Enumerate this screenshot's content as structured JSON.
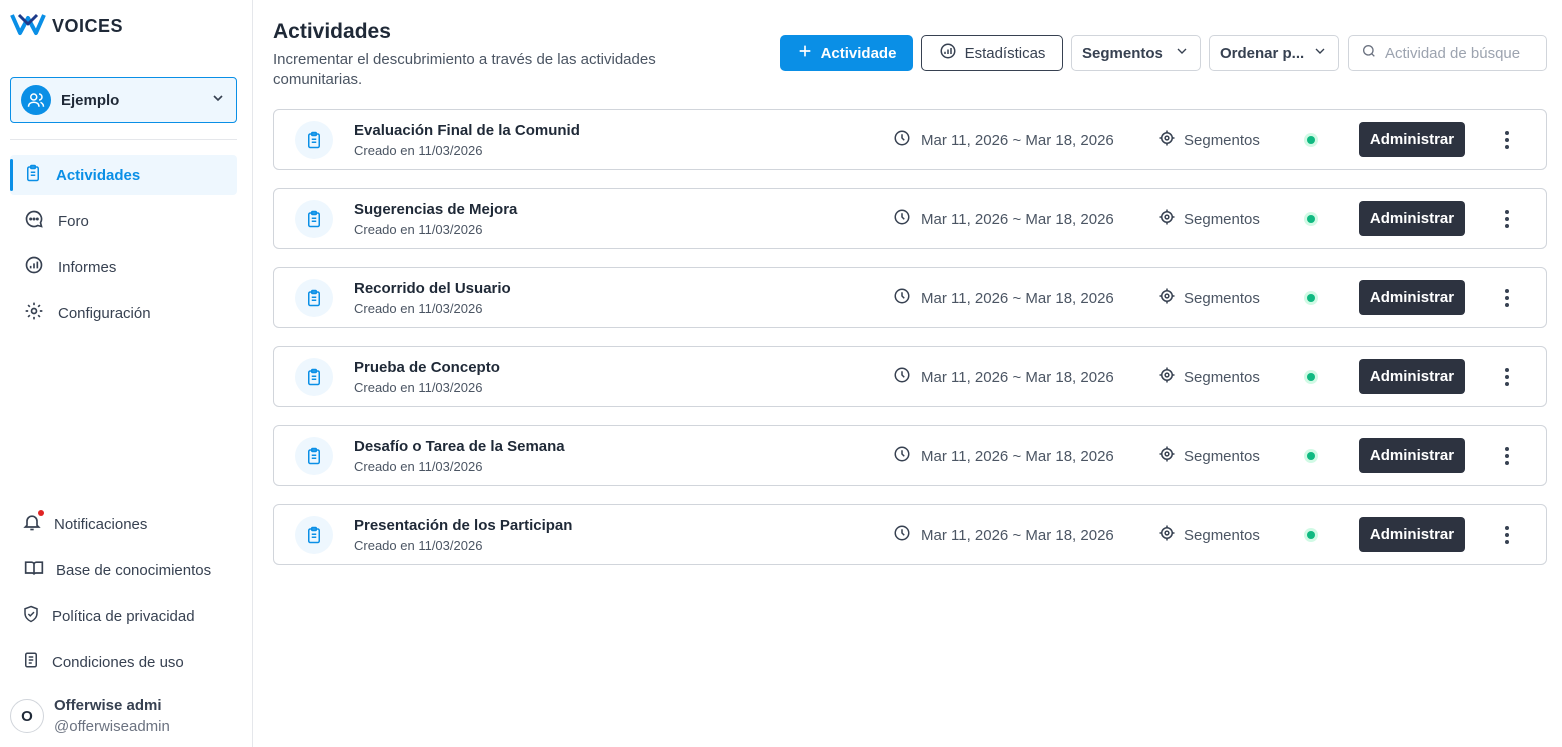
{
  "brand": {
    "name": "VOICES",
    "accent": "#0a8fe6"
  },
  "sidebar": {
    "workspace": "Ejemplo",
    "items": [
      {
        "label": "Actividades",
        "icon": "clipboard-icon",
        "active": true
      },
      {
        "label": "Foro",
        "icon": "chat-icon"
      },
      {
        "label": "Informes",
        "icon": "chart-icon"
      },
      {
        "label": "Configuración",
        "icon": "gear-icon"
      }
    ],
    "bottom": [
      {
        "label": "Notificaciones",
        "icon": "bell-icon"
      },
      {
        "label": "Base de conocimientos",
        "icon": "book-icon"
      },
      {
        "label": "Política de privacidad",
        "icon": "shield-icon"
      },
      {
        "label": "Condiciones de uso",
        "icon": "document-icon"
      }
    ],
    "user": {
      "initial": "O",
      "name": "Offerwise admi",
      "handle": "@offerwiseadmin"
    }
  },
  "header": {
    "title": "Actividades",
    "subtitle": "Incrementar el descubrimiento a través de las actividades comunitarias.",
    "add_label": "Actividade",
    "stats_label": "Estadísticas",
    "segments_label": "Segmentos",
    "sort_label": "Ordenar p...",
    "search_placeholder": "Actividad de búsque"
  },
  "activities": [
    {
      "title": "Evaluación Final de la Comunid",
      "created": "Creado en 11/03/2026",
      "dates": "Mar 11, 2026 ~ Mar 18, 2026",
      "segments": "Segmentos",
      "manage": "Administrar"
    },
    {
      "title": "Sugerencias de Mejora",
      "created": "Creado en 11/03/2026",
      "dates": "Mar 11, 2026 ~ Mar 18, 2026",
      "segments": "Segmentos",
      "manage": "Administrar"
    },
    {
      "title": "Recorrido del Usuario",
      "created": "Creado en 11/03/2026",
      "dates": "Mar 11, 2026 ~ Mar 18, 2026",
      "segments": "Segmentos",
      "manage": "Administrar"
    },
    {
      "title": "Prueba de Concepto",
      "created": "Creado en 11/03/2026",
      "dates": "Mar 11, 2026 ~ Mar 18, 2026",
      "segments": "Segmentos",
      "manage": "Administrar"
    },
    {
      "title": "Desafío o Tarea de la Semana",
      "created": "Creado en 11/03/2026",
      "dates": "Mar 11, 2026 ~ Mar 18, 2026",
      "segments": "Segmentos",
      "manage": "Administrar"
    },
    {
      "title": "Presentación de los Participan",
      "created": "Creado en 11/03/2026",
      "dates": "Mar 11, 2026 ~ Mar 18, 2026",
      "segments": "Segmentos",
      "manage": "Administrar"
    }
  ]
}
